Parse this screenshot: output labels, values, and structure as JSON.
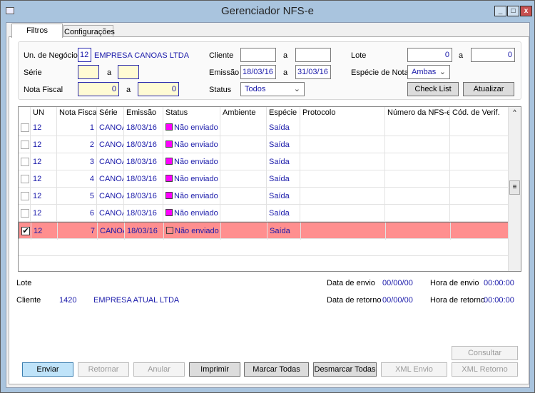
{
  "window": {
    "title": "Gerenciador NFS-e"
  },
  "tabs": [
    {
      "label": "Filtros"
    },
    {
      "label": "Configurações"
    }
  ],
  "filters": {
    "un_negocio_label": "Un. de Negócio",
    "un_negocio_value": "12",
    "un_negocio_name": "EMPRESA CANOAS LTDA",
    "serie_label": "Série",
    "serie_from": "",
    "serie_to": "",
    "nota_fiscal_label": "Nota Fiscal",
    "nota_from": "0",
    "nota_to": "0",
    "cliente_label": "Cliente",
    "cliente_from": "",
    "cliente_to": "",
    "emissao_label": "Emissão",
    "emissao_from": "18/03/16",
    "emissao_to": "31/03/16",
    "status_label": "Status",
    "status_value": "Todos",
    "lote_label": "Lote",
    "lote_from": "0",
    "lote_to": "0",
    "especie_label": "Espécie de Nota",
    "especie_value": "Ambas",
    "a": "a",
    "check_list": "Check List",
    "atualizar": "Atualizar"
  },
  "grid": {
    "columns": [
      "UN",
      "Nota Fiscal",
      "Série",
      "Emissão",
      "Status",
      "Ambiente",
      "Espécie",
      "Protocolo",
      "Número da NFS-e",
      "Cód. de Verif."
    ],
    "rows": [
      {
        "checked": false,
        "un": "12",
        "nota": "1",
        "serie": "CANOA",
        "emissao": "18/03/16",
        "status": "Não enviado",
        "ambiente": "",
        "especie": "Saída",
        "protocolo": "",
        "numero": "",
        "cod": ""
      },
      {
        "checked": false,
        "un": "12",
        "nota": "2",
        "serie": "CANOA",
        "emissao": "18/03/16",
        "status": "Não enviado",
        "ambiente": "",
        "especie": "Saída",
        "protocolo": "",
        "numero": "",
        "cod": ""
      },
      {
        "checked": false,
        "un": "12",
        "nota": "3",
        "serie": "CANOA",
        "emissao": "18/03/16",
        "status": "Não enviado",
        "ambiente": "",
        "especie": "Saída",
        "protocolo": "",
        "numero": "",
        "cod": ""
      },
      {
        "checked": false,
        "un": "12",
        "nota": "4",
        "serie": "CANOA",
        "emissao": "18/03/16",
        "status": "Não enviado",
        "ambiente": "",
        "especie": "Saída",
        "protocolo": "",
        "numero": "",
        "cod": ""
      },
      {
        "checked": false,
        "un": "12",
        "nota": "5",
        "serie": "CANOA",
        "emissao": "18/03/16",
        "status": "Não enviado",
        "ambiente": "",
        "especie": "Saída",
        "protocolo": "",
        "numero": "",
        "cod": ""
      },
      {
        "checked": false,
        "un": "12",
        "nota": "6",
        "serie": "CANOA",
        "emissao": "18/03/16",
        "status": "Não enviado",
        "ambiente": "",
        "especie": "Saída",
        "protocolo": "",
        "numero": "",
        "cod": ""
      },
      {
        "checked": true,
        "un": "12",
        "nota": "7",
        "serie": "CANOA",
        "emissao": "18/03/16",
        "status": "Não enviado",
        "ambiente": "",
        "especie": "Saída",
        "protocolo": "",
        "numero": "",
        "cod": ""
      }
    ],
    "status_color": "#ff00ff",
    "selected_color": "#ff8f8f"
  },
  "details": {
    "lote_label": "Lote",
    "cliente_label": "Cliente",
    "cliente_code": "1420",
    "cliente_name": "EMPRESA ATUAL LTDA",
    "data_envio_label": "Data de envio",
    "data_envio": "00/00/00",
    "hora_envio_label": "Hora de envio",
    "hora_envio": "00:00:00",
    "data_retorno_label": "Data de retorno",
    "data_retorno": "00/00/00",
    "hora_retorno_label": "Hora de retorno",
    "hora_retorno": "00:00:00"
  },
  "buttons": {
    "consultar": "Consultar Protocolo",
    "enviar": "Enviar",
    "retornar": "Retornar",
    "anular": "Anular",
    "imprimir": "Imprimir",
    "marcar": "Marcar Todas",
    "desmarcar": "Desmarcar Todas",
    "xml_envio": "XML Envio",
    "xml_retorno": "XML Retorno"
  }
}
